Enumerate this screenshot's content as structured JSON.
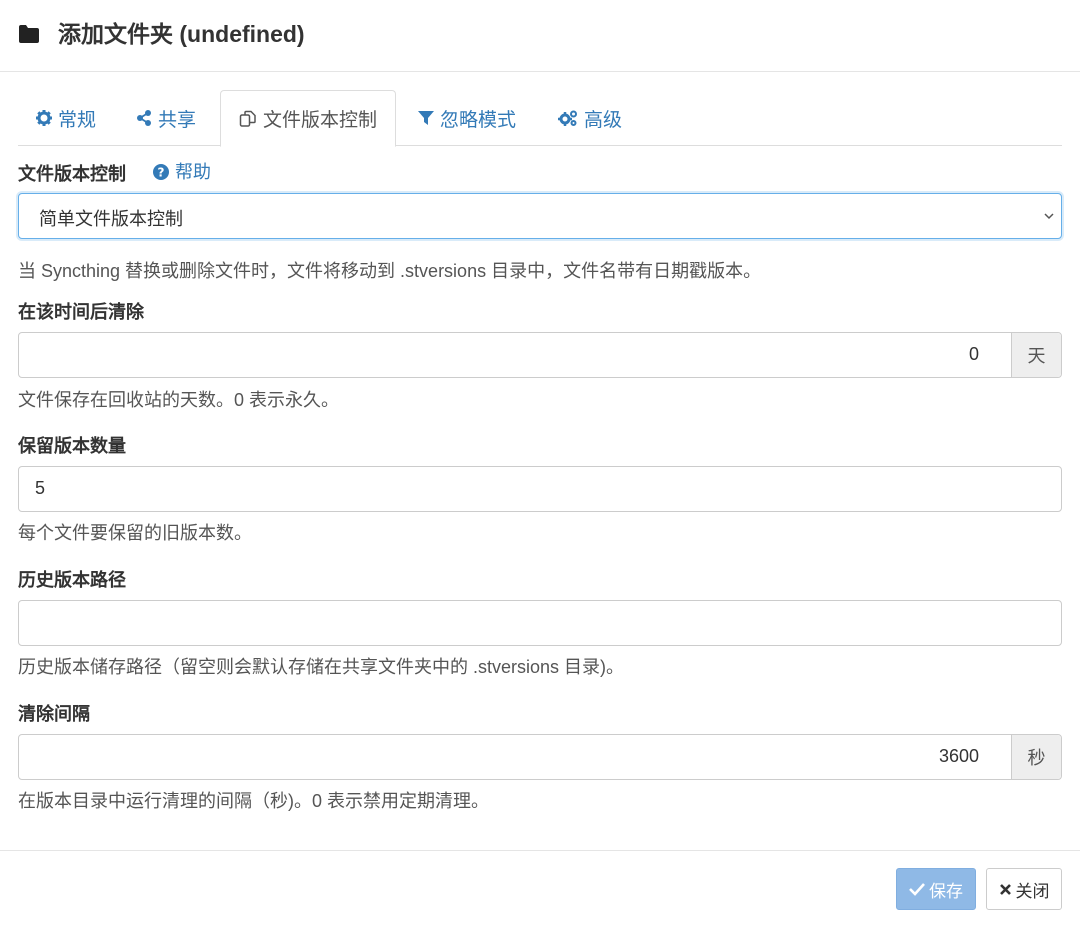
{
  "dialog": {
    "title": "添加文件夹 (undefined)",
    "icon": "folder-icon"
  },
  "tabs": [
    {
      "label": "常规",
      "icon": "gear-icon",
      "active": false
    },
    {
      "label": "共享",
      "icon": "share-icon",
      "active": false
    },
    {
      "label": "文件版本控制",
      "icon": "copy-icon",
      "active": true
    },
    {
      "label": "忽略模式",
      "icon": "filter-icon",
      "active": false
    },
    {
      "label": "高级",
      "icon": "gears-icon",
      "active": false
    }
  ],
  "versioning": {
    "label": "文件版本控制",
    "help_link": "帮助",
    "selected": "简单文件版本控制",
    "description": "当 Syncthing 替换或删除文件时，文件将移动到 .stversions 目录中，文件名带有日期戳版本。"
  },
  "cleanout": {
    "label": "在该时间后清除",
    "value": "0",
    "unit": "天",
    "help": "文件保存在回收站的天数。0 表示永久。"
  },
  "keep": {
    "label": "保留版本数量",
    "value": "5",
    "help": "每个文件要保留的旧版本数。"
  },
  "path": {
    "label": "历史版本路径",
    "value": "",
    "help": "历史版本储存路径（留空则会默认存储在共享文件夹中的 .stversions 目录)。"
  },
  "interval": {
    "label": "清除间隔",
    "value": "3600",
    "unit": "秒",
    "help": "在版本目录中运行清理的间隔（秒)。0 表示禁用定期清理。"
  },
  "buttons": {
    "save": "保存",
    "close": "关闭"
  },
  "colors": {
    "link": "#337ab7",
    "save_button": "#8fb9e6"
  }
}
